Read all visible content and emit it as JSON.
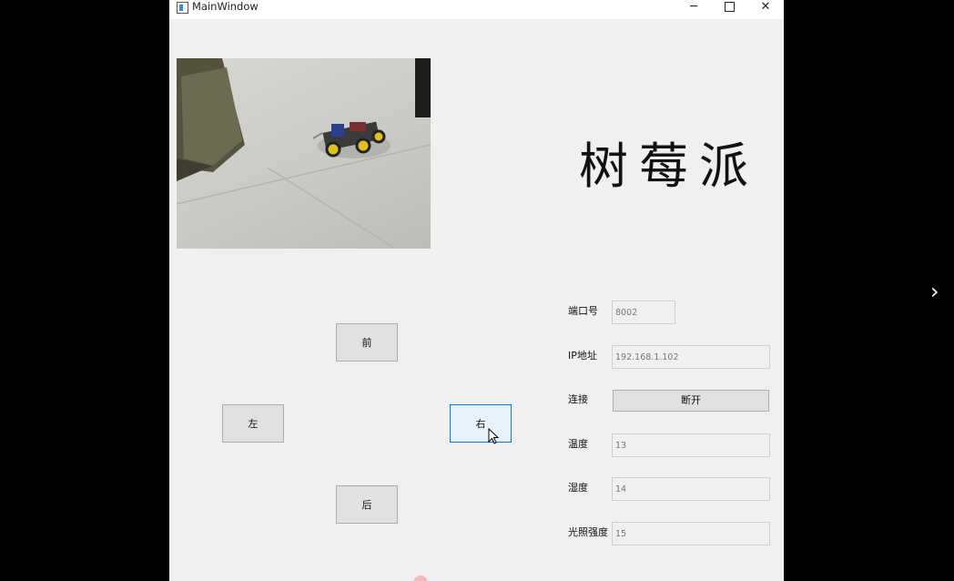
{
  "window": {
    "title": "MainWindow",
    "controls": {
      "minimize": "─",
      "close": "✕"
    }
  },
  "brand": {
    "title": "树莓派"
  },
  "camera": {
    "icon": "camera-feed-image"
  },
  "controls": {
    "forward": "前",
    "left": "左",
    "right": "右",
    "back": "后"
  },
  "fields": {
    "port": {
      "label": "端口号",
      "value": "8002"
    },
    "ip": {
      "label": "IP地址",
      "value": "192.168.1.102"
    },
    "connect": {
      "label": "连接",
      "button": "断开"
    },
    "temperature": {
      "label": "温度",
      "value": "13"
    },
    "humidity": {
      "label": "湿度",
      "value": "14"
    },
    "light": {
      "label": "光照强度",
      "value": "15"
    }
  },
  "viewer": {
    "next_icon": "chevron-right-icon",
    "next": "›"
  }
}
